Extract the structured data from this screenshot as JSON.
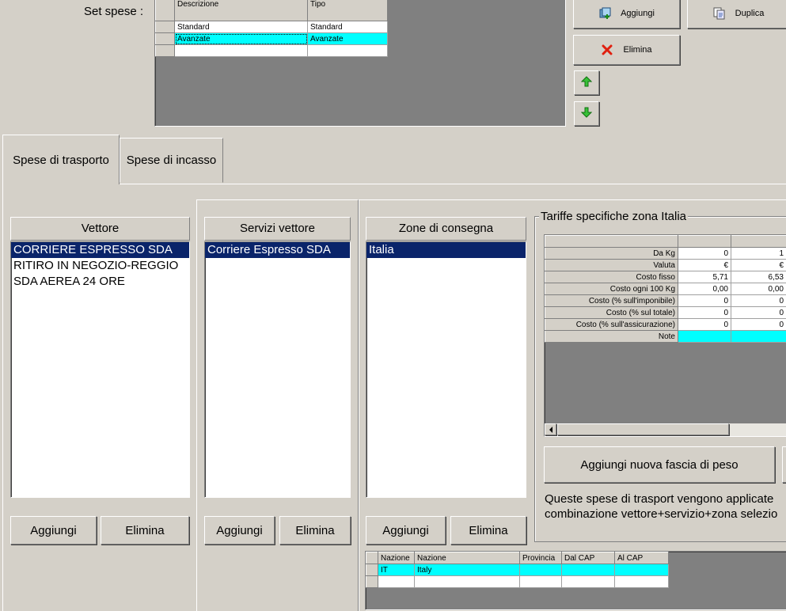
{
  "set_spese": {
    "label": "Set spese :",
    "columns": [
      "Descrizione",
      "Tipo"
    ],
    "rows": [
      {
        "descrizione": "Standard",
        "tipo": "Standard"
      },
      {
        "descrizione": "Avanzate",
        "tipo": "Avanzate"
      }
    ],
    "buttons": {
      "aggiungi": "Aggiungi",
      "duplica": "Duplica",
      "elimina": "Elimina"
    }
  },
  "tabs": [
    {
      "label": "Spese di trasporto",
      "active": true
    },
    {
      "label": "Spese di incasso",
      "active": false
    }
  ],
  "vettore": {
    "header": "Vettore",
    "items": [
      "CORRIERE ESPRESSO SDA",
      "RITIRO IN NEGOZIO-REGGIO",
      "SDA AEREA 24 ORE"
    ],
    "selected": 0,
    "add_label": "Aggiungi",
    "delete_label": "Elimina"
  },
  "servizi": {
    "header": "Servizi vettore",
    "items": [
      "Corriere Espresso SDA"
    ],
    "selected": 0,
    "add_label": "Aggiungi",
    "delete_label": "Elimina"
  },
  "zone": {
    "header": "Zone di consegna",
    "items": [
      "Italia"
    ],
    "selected": 0,
    "add_label": "Aggiungi",
    "delete_label": "Elimina",
    "grid_columns": [
      "Nazione",
      "Nazione",
      "Provincia",
      "Dal CAP",
      "Al CAP"
    ],
    "grid_rows": [
      [
        "IT",
        "Italy",
        "",
        "",
        ""
      ]
    ]
  },
  "tariffe": {
    "title": "Tariffe specifiche zona Italia",
    "rows": [
      {
        "label": "Da Kg",
        "v1": "0",
        "v2": "1"
      },
      {
        "label": "Valuta",
        "v1": "€",
        "v2": "€"
      },
      {
        "label": "Costo fisso",
        "v1": "5,71",
        "v2": "6,53"
      },
      {
        "label": "Costo ogni 100 Kg",
        "v1": "0,00",
        "v2": "0,00"
      },
      {
        "label": "Costo (% sull'imponibile)",
        "v1": "0",
        "v2": "0"
      },
      {
        "label": "Costo (% sul totale)",
        "v1": "0",
        "v2": "0"
      },
      {
        "label": "Costo (% sull'assicurazione)",
        "v1": "0",
        "v2": "0"
      },
      {
        "label": "Note",
        "v1": "",
        "v2": ""
      }
    ],
    "add_weight_label": "Aggiungi nuova fascia di peso",
    "note_line1": "Queste spese di trasport vengono applicate",
    "note_line2": "combinazione vettore+servizio+zona selezio"
  },
  "colors": {
    "selection": "#0a246a",
    "highlight": "#00ffff",
    "background": "#d4d0c8",
    "dark_area": "#808080"
  },
  "icons": [
    "add-set-icon",
    "duplicate-icon",
    "delete-x-icon",
    "arrow-up-icon",
    "arrow-down-icon"
  ]
}
